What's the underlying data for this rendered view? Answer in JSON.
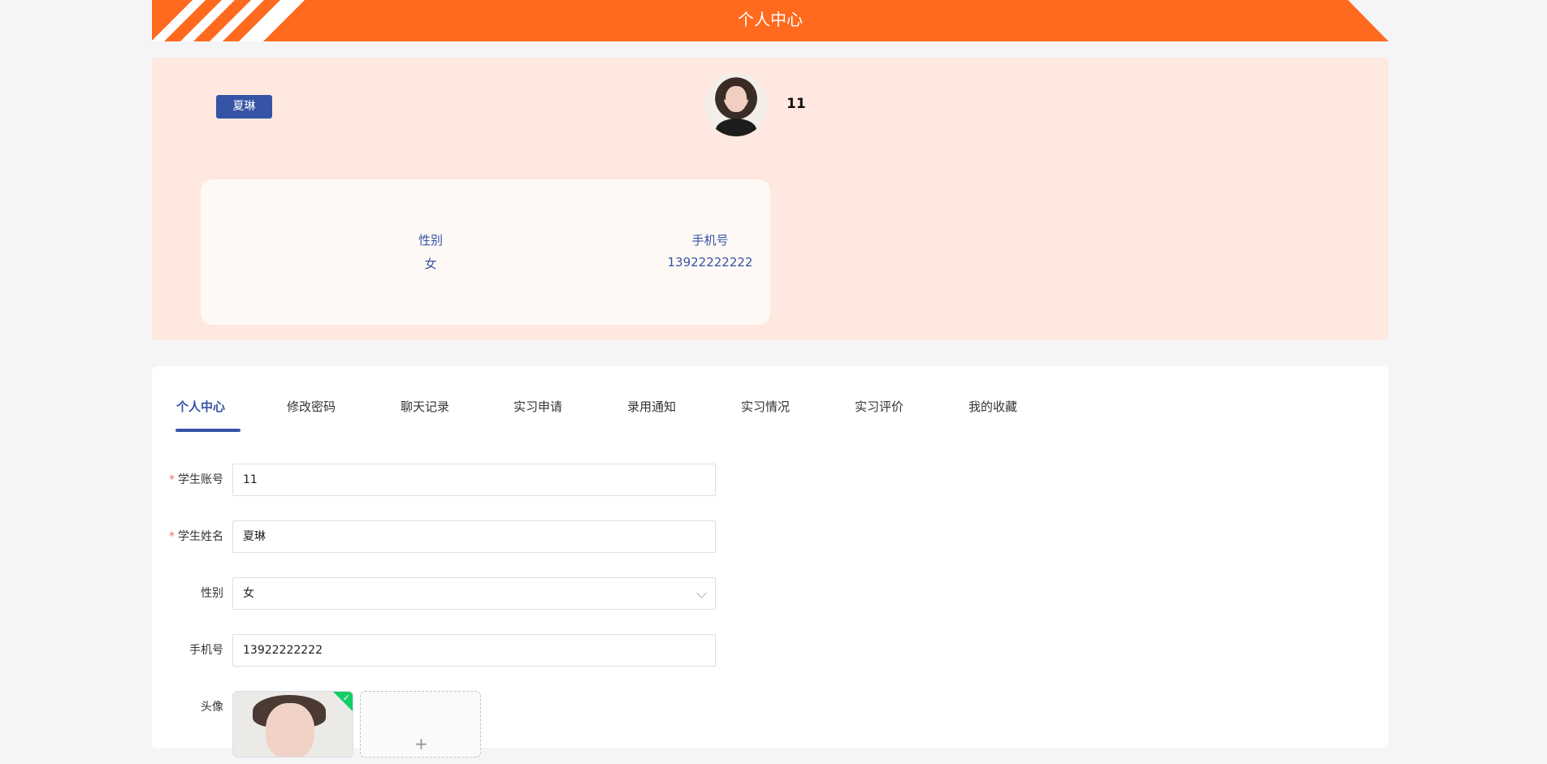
{
  "header": {
    "title": "个人中心"
  },
  "profile": {
    "name": "夏琳",
    "account": "11",
    "gender_label": "性别",
    "gender_value": "女",
    "phone_label": "手机号",
    "phone_value": "13922222222"
  },
  "tabs": [
    {
      "label": "个人中心",
      "active": true
    },
    {
      "label": "修改密码"
    },
    {
      "label": "聊天记录"
    },
    {
      "label": "实习申请"
    },
    {
      "label": "录用通知"
    },
    {
      "label": "实习情况"
    },
    {
      "label": "实习评价"
    },
    {
      "label": "我的收藏"
    }
  ],
  "form": {
    "account": {
      "label": "学生账号",
      "value": "11",
      "required": true
    },
    "name": {
      "label": "学生姓名",
      "value": "夏琳",
      "required": true
    },
    "gender": {
      "label": "性别",
      "value": "女"
    },
    "phone": {
      "label": "手机号",
      "value": "13922222222"
    },
    "avatar": {
      "label": "头像",
      "add_symbol": "+"
    }
  },
  "colors": {
    "accent": "#ff6a1f",
    "primary": "#3554a5",
    "profile_bg": "#ffe8df"
  }
}
